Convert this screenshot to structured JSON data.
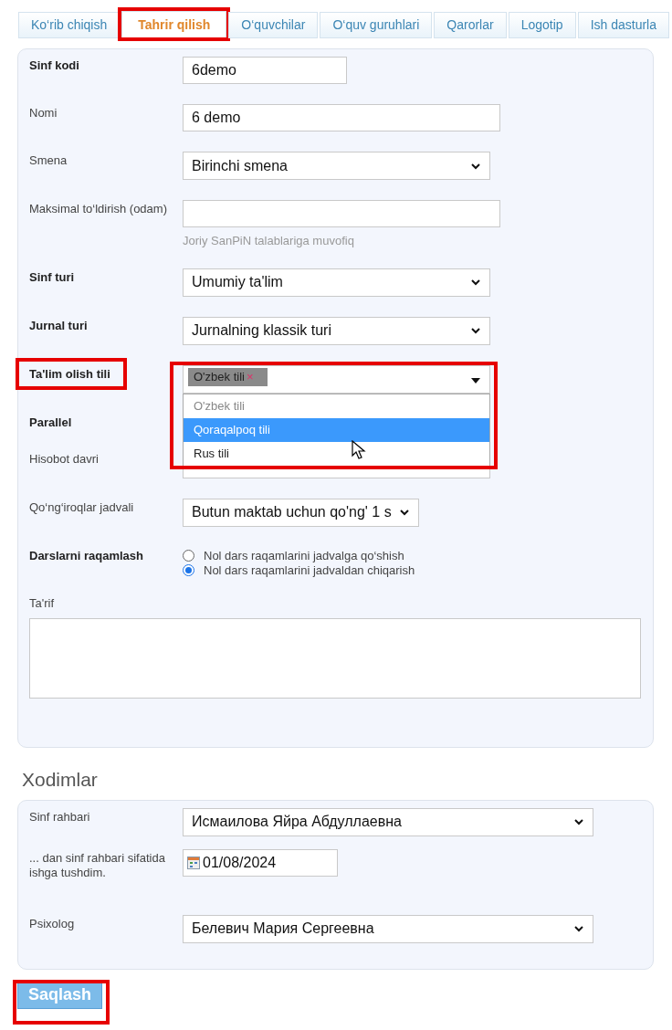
{
  "tabs": [
    {
      "label": "Ko‘rib chiqish",
      "selected": false,
      "highlighted": false
    },
    {
      "label": "Tahrir qilish",
      "selected": true,
      "highlighted": true
    },
    {
      "label": "O‘quvchilar",
      "selected": false,
      "highlighted": false
    },
    {
      "label": "O‘quv guruhlari",
      "selected": false,
      "highlighted": false
    },
    {
      "label": "Qarorlar",
      "selected": false,
      "highlighted": false
    },
    {
      "label": "Logotip",
      "selected": false,
      "highlighted": false
    },
    {
      "label": "Ish dasturla",
      "selected": false,
      "highlighted": false
    }
  ],
  "form": {
    "fields": [
      {
        "kind": "short_text",
        "label": "Sinf kodi",
        "bold": true,
        "value": "6demo"
      },
      {
        "kind": "text",
        "label": "Nomi",
        "bold": false,
        "value": "6 demo"
      },
      {
        "kind": "select",
        "label": "Smena",
        "bold": false,
        "value": "Birinchi smena"
      },
      {
        "kind": "text",
        "label": "Maksimal to‘ldirish (odam)",
        "bold": false,
        "hint": "Joriy SanPiN talablariga muvofiq"
      },
      {
        "kind": "select",
        "label": "Sinf turi",
        "bold": true,
        "value": "Umumiy ta'lim"
      },
      {
        "kind": "select",
        "label": "Jurnal turi",
        "bold": true,
        "value": "Jurnalning klassik turi"
      },
      {
        "kind": "tags",
        "label": "Ta'lim olish tili",
        "bold": true,
        "highlighted": true,
        "tags": [
          "O'zbek tili"
        ],
        "remove_mark": "×",
        "options": [
          {
            "label": "O'zbek tili",
            "selected": false,
            "disabled": true
          },
          {
            "label": "Qoraqalpoq tili",
            "selected": true,
            "disabled": false
          },
          {
            "label": "Rus tili",
            "selected": false,
            "disabled": false
          }
        ]
      },
      {
        "kind": "none",
        "label": "Parallel",
        "bold": true
      },
      {
        "kind": "covered",
        "label": "Hisobot davri",
        "bold": false
      },
      {
        "kind": "short_select",
        "label": "Qo‘ng‘iroqlar jadvali",
        "bold": false,
        "value": "Butun maktab uchun qo'ng' 1 s"
      },
      {
        "kind": "radios",
        "label": "Darslarni raqamlash",
        "bold": true,
        "options": [
          {
            "label": "Nol dars raqamlarini jadvalga qo‘shish",
            "checked": false
          },
          {
            "label": "Nol dars raqamlarini jadvaldan chiqarish",
            "checked": true
          }
        ]
      },
      {
        "kind": "textarea",
        "label": "Ta'rif",
        "bold": false
      }
    ]
  },
  "staff": {
    "title": "Xodimlar",
    "fields": [
      {
        "kind": "select",
        "label": "Sinf rahbari",
        "value": "Исмаилова Яйра Абдуллаевна"
      },
      {
        "kind": "date",
        "label": "... dan sinf rahbari sifatida ishga tushdim.",
        "value": "01/08/2024"
      },
      {
        "kind": "select",
        "label": "Psixolog",
        "value": "Белевич Мария Сергеевна"
      }
    ]
  },
  "save_button": {
    "label": "Saqlash",
    "highlighted": true
  }
}
